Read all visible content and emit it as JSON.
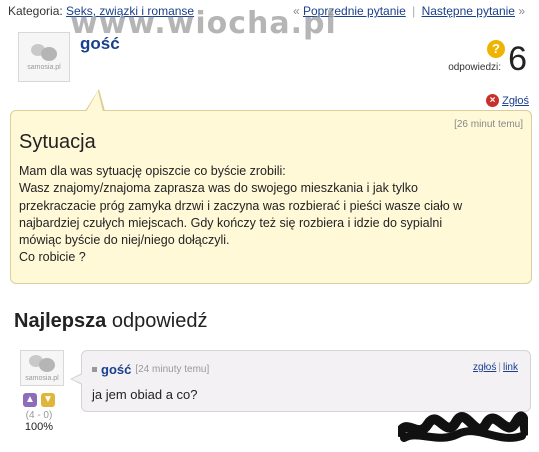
{
  "topbar": {
    "category_label": "Kategoria:",
    "category_link": "Seks, związki i romanse",
    "prev_arrow": "«",
    "prev_link": "Poprzednie pytanie",
    "separator": "|",
    "next_link": "Następne pytanie",
    "next_arrow": "»"
  },
  "watermark": "www.wiocha.pl",
  "asker": {
    "name": "gość",
    "avatar_brand": "samosia.pl"
  },
  "answers_stat": {
    "icon": "?",
    "label": "odpowiedzi:",
    "count": "6"
  },
  "report_label": "Zgłoś",
  "question": {
    "time": "[26 minut temu]",
    "title": "Sytuacja",
    "lines": [
      "Mam dla was sytuację opiszcie co byście zrobili:",
      "Wasz znajomy/znajoma zaprasza was do swojego mieszkania i jak tylko",
      "przekraczacie próg zamyka drzwi i zaczyna was rozbierać i pieści wasze ciało w",
      "najbardziej czułych miejscach. Gdy kończy też się rozbiera i idzie do sypialni",
      "mówiąc byście do niej/niego dołączyli.",
      "Co robicie ?"
    ]
  },
  "best": {
    "bold": "Najlepsza",
    "rest": " odpowiedź"
  },
  "best_answer": {
    "user": "gość",
    "time": "[24 minuty temu]",
    "report_link": "zgłoś",
    "separator": "|",
    "link": "link",
    "text": "ja jem obiad a co?",
    "avatar_brand": "samosia.pl"
  },
  "votes": {
    "score": "(4 - 0)",
    "percent": "100%"
  },
  "colors": {
    "link": "#1a3f8c",
    "question_bg": "#fff9d8",
    "answer_bg": "#f3f1f4"
  }
}
